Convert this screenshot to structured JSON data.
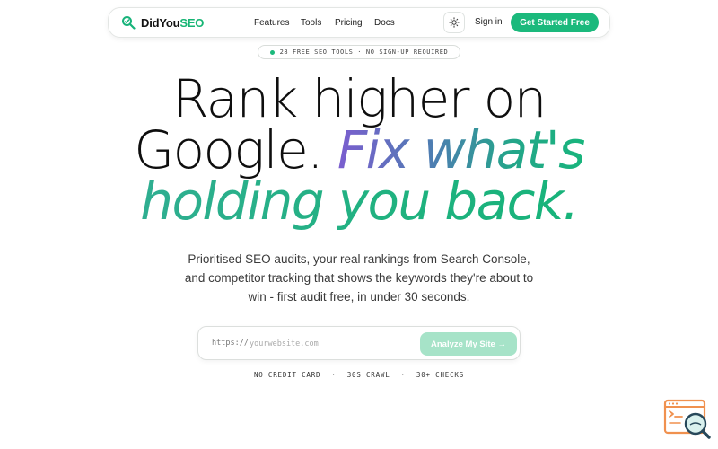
{
  "nav": {
    "brand_part1": "DidYou",
    "brand_part2": "SEO",
    "links": [
      "Features",
      "Tools",
      "Pricing",
      "Docs"
    ],
    "signin": "Sign in",
    "cta": "Get Started Free"
  },
  "badge": {
    "text": "28 FREE SEO TOOLS · NO SIGN-UP REQUIRED"
  },
  "hero": {
    "line1": "Rank higher on",
    "line2_plain": "Google.",
    "line2_highlight": "Fix what's",
    "line3": "holding you back."
  },
  "subtext": "Prioritised SEO audits, your real rankings from Search Console, and competitor tracking that shows the keywords they're about to win - first audit free, in under 30 seconds.",
  "search": {
    "prefix": "https://",
    "placeholder": "yourwebsite.com",
    "value": "",
    "button": "Analyze My Site →"
  },
  "trust": [
    "NO CREDIT CARD",
    "30S CRAWL",
    "30+ CHECKS"
  ],
  "colors": {
    "brand_green": "#1bb97c",
    "button_disabled": "#a6e3c8",
    "gradient_start": "#7b5ecf",
    "float_icon_orange": "#f0914f"
  },
  "icons": {
    "brand": "search-logo-icon",
    "theme": "sun-icon",
    "floating": "browser-search-icon"
  }
}
